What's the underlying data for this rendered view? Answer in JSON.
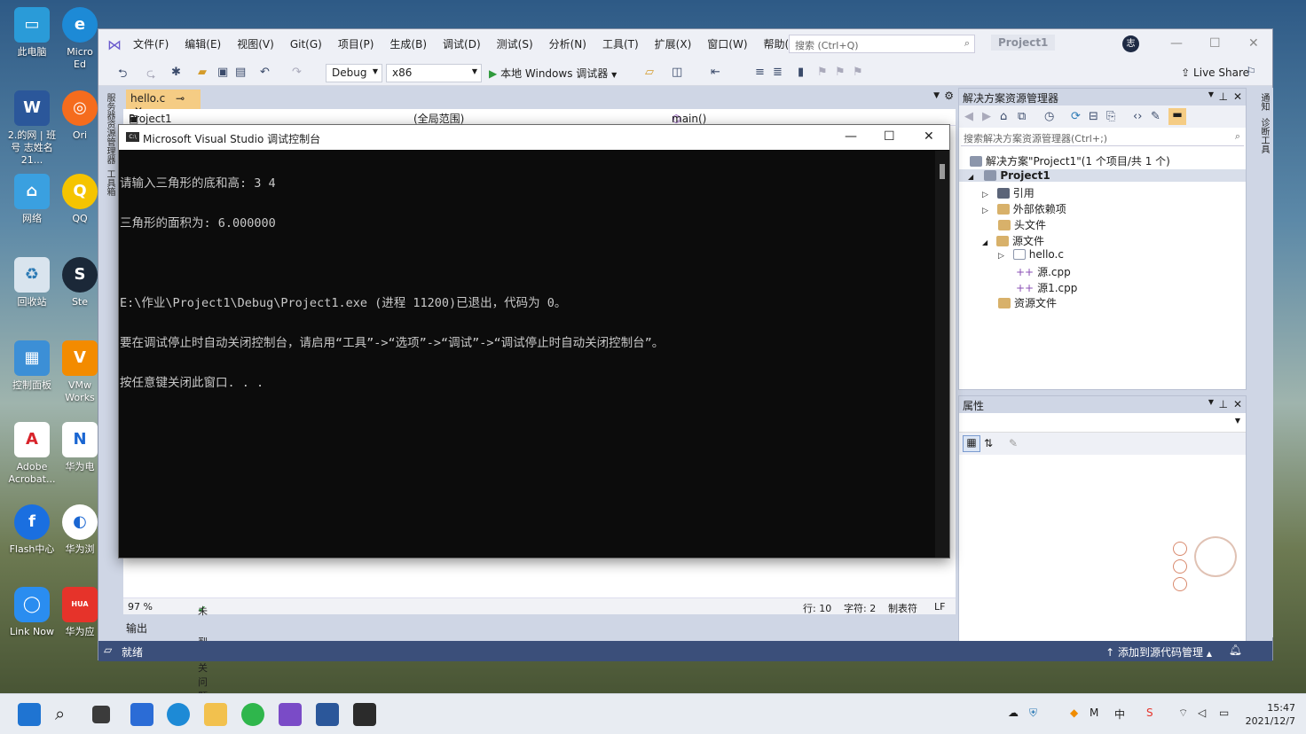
{
  "desktop": {
    "icons": [
      {
        "label": "此电脑"
      },
      {
        "label": "Micro Ed"
      },
      {
        "label": "2.的网 | 班号 志姓名21..."
      },
      {
        "label": "Ori"
      },
      {
        "label": "网络"
      },
      {
        "label": "QQ"
      },
      {
        "label": "回收站"
      },
      {
        "label": "Ste"
      },
      {
        "label": "控制面板"
      },
      {
        "label": "VMw Works"
      },
      {
        "label": "Adobe Acrobat..."
      },
      {
        "label": "华为电"
      },
      {
        "label": "Flash中心"
      },
      {
        "label": "华为浏"
      },
      {
        "label": "Link Now"
      },
      {
        "label": "华为应"
      }
    ]
  },
  "vs": {
    "menu": [
      "文件(F)",
      "编辑(E)",
      "视图(V)",
      "Git(G)",
      "项目(P)",
      "生成(B)",
      "调试(D)",
      "测试(S)",
      "分析(N)",
      "工具(T)",
      "扩展(X)",
      "窗口(W)",
      "帮助(H)"
    ],
    "search_placeholder": "搜索 (Ctrl+Q)",
    "project_badge": "Project1",
    "avatar_text": "志",
    "toolbar": {
      "config": "Debug",
      "platform": "x86",
      "run_label": "本地 Windows 调试器",
      "live_share": "Live Share"
    },
    "left_strip": [
      "服务器资源管理器",
      "工具箱"
    ],
    "right_strip": [
      "通知",
      "诊断工具"
    ],
    "editor": {
      "tab": "hello.c",
      "nav_project": "Project1",
      "nav_scope": "(全局范围)",
      "nav_func": "main()",
      "zoom": "97 %",
      "issues": "未找到相关问题",
      "line": "行: 10",
      "col": "字符: 2",
      "tabs": "制表符",
      "eol": "LF"
    },
    "output_label": "输出",
    "status": {
      "ready": "就绪",
      "source_control": "添加到源代码管理"
    },
    "solution_explorer": {
      "title": "解决方案资源管理器",
      "search_placeholder": "搜索解决方案资源管理器(Ctrl+;)",
      "items": [
        {
          "label": "解决方案\"Project1\"(1 个项目/共 1 个)"
        },
        {
          "label": "Project1"
        },
        {
          "label": "引用"
        },
        {
          "label": "外部依赖项"
        },
        {
          "label": "头文件"
        },
        {
          "label": "源文件"
        },
        {
          "label": "hello.c"
        },
        {
          "label": "源.cpp"
        },
        {
          "label": "源1.cpp"
        },
        {
          "label": "资源文件"
        }
      ]
    },
    "properties": {
      "title": "属性"
    }
  },
  "console": {
    "title": "Microsoft Visual Studio 调试控制台",
    "lines": [
      "请输入三角形的底和高: 3 4",
      "三角形的面积为: 6.000000",
      "",
      "E:\\作业\\Project1\\Debug\\Project1.exe (进程 11200)已退出，代码为 0。",
      "要在调试停止时自动关闭控制台，请启用“工具”->“选项”->“调试”->“调试停止时自动关闭控制台”。",
      "按任意键关闭此窗口. . ."
    ]
  },
  "taskbar": {
    "time": "15:47",
    "date": "2021/12/7",
    "ime": "中"
  }
}
